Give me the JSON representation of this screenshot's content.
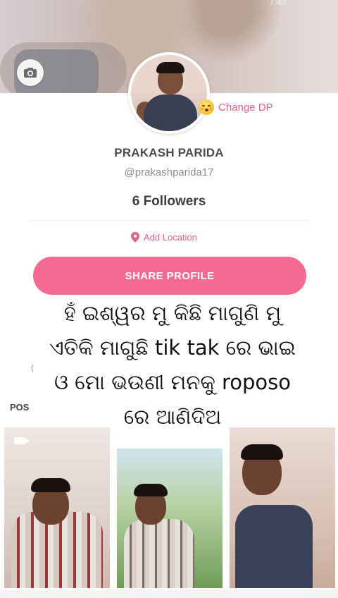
{
  "status": {
    "time": "7:40"
  },
  "profile": {
    "change_dp_label": "Change DP",
    "name": "PRAKASH PARIDA",
    "handle": "@prakashparida17",
    "followers": "6 Followers",
    "add_location_label": "Add Location",
    "share_label": "SHARE PROFILE"
  },
  "posts": {
    "label": "POS",
    "tick": "("
  },
  "caption": {
    "lines": [
      "ହଁ ଇଶ୍ୱର ମୁ କିଛି ମାଗୁଣି ମୁ",
      "ଏତିକି ମାଗୁଛି tik tak ରେ ଭାଇ",
      "ଓ ମୋ ଭଉଣୀ ମନକୁ roposo",
      "ରେ ଆଣିଦିଅ"
    ]
  },
  "colors": {
    "accent": "#f56a93",
    "accent_text": "#e0628a"
  },
  "icons": [
    "camera-icon",
    "emoji-icon",
    "location-pin-icon",
    "video-icon"
  ]
}
